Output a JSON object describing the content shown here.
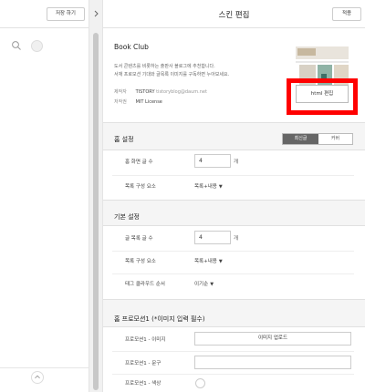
{
  "left": {
    "save_button": "저장 하기",
    "scroll_up_icon": "chevron-up-icon",
    "search_icon": "search-icon"
  },
  "header": {
    "title": "스킨 편집",
    "done_button": "적용"
  },
  "skin": {
    "name": "Book Club",
    "description_line1": "도서 콘텐츠를 비롯하는 출판사 블로그에 추천합니다.",
    "description_line2": "서재 프로모션 기대와 글목록 이미지를 구독하면 누아보세요.",
    "maker_label": "제작자",
    "maker_value": "TISTORY",
    "maker_email": "tistoryblog@daum.net",
    "license_label": "저작권",
    "license_value": "MIT License",
    "html_edit_button": "html 편집"
  },
  "home_settings": {
    "title": "홈 설정",
    "tab_active": "최신글",
    "tab_inactive": "커버",
    "rows": [
      {
        "label": "홈 화면 글 수",
        "value": "4",
        "unit": "개"
      },
      {
        "label": "목록 구성 요소",
        "select": "목록+내용"
      }
    ]
  },
  "basic_settings": {
    "title": "기본 설정",
    "rows": [
      {
        "label": "글 목록 글 수",
        "value": "4",
        "unit": "개"
      },
      {
        "label": "목록 구성 요소",
        "select": "목록+내용"
      },
      {
        "label": "태그 클라우드 순서",
        "select": "이기순"
      }
    ]
  },
  "promo": {
    "title": "홈 프로모션1 (*이미지 입력 필수)",
    "image_label": "프로모션1 - 이미지",
    "upload_button": "이미지 업로드",
    "text_label": "프로모션1 - 문구",
    "color_label": "프로모션1 - 색상"
  },
  "colors": {
    "accent_red": "#ff0000",
    "toggle_active": "#666666",
    "panel_bg": "#f5f5f5"
  }
}
